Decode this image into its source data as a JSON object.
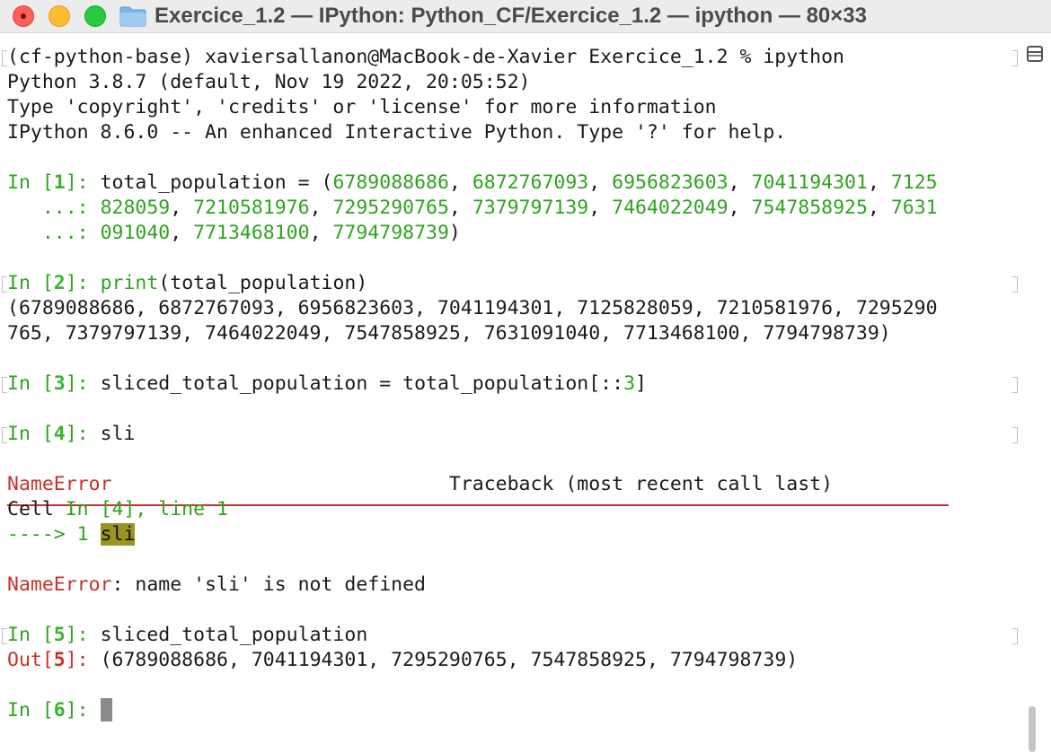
{
  "window": {
    "title": "Exercice_1.2 — IPython: Python_CF/Exercice_1.2 — ipython — 80×33",
    "icons": {
      "close": "close-icon",
      "minimize": "minimize-icon",
      "maximize": "maximize-icon",
      "folder": "folder-icon",
      "split": "split-view-icon"
    }
  },
  "colors": {
    "prompt_green": "#2fa31f",
    "error_red": "#c4332a",
    "highlight": "#9a9420"
  },
  "terminal": {
    "shell_prompt": "(cf-python-base) xaviersallanon@MacBook-de-Xavier Exercice_1.2 % ipython",
    "banner": [
      "Python 3.8.7 (default, Nov 19 2022, 20:05:52)",
      "Type 'copyright', 'credits' or 'license' for more information",
      "IPython 8.6.0 -- An enhanced Interactive Python. Type '?' for help."
    ],
    "cell1": {
      "prompt_in": "In [",
      "num": "1",
      "prompt_close": "]: ",
      "code_start": "total_population = (",
      "l1_values": [
        "6789088686",
        "6872767093",
        "6956823603",
        "7041194301",
        "7125"
      ],
      "cont": "   ...: ",
      "l2_values": [
        "828059",
        "7210581976",
        "7295290765",
        "7379797139",
        "7464022049",
        "7547858925",
        "7631"
      ],
      "l3_values": [
        "091040",
        "7713468100",
        "7794798739"
      ],
      "code_end": ")"
    },
    "cell2": {
      "num": "2",
      "func": "print",
      "args": "(total_population)",
      "output": [
        "(6789088686, 6872767093, 6956823603, 7041194301, 7125828059, 7210581976, 7295290",
        "765, 7379797139, 7464022049, 7547858925, 7631091040, 7713468100, 7794798739)"
      ]
    },
    "cell3": {
      "num": "3",
      "code_a": "sliced_total_population = total_population[::",
      "code_num": "3",
      "code_b": "]"
    },
    "cell4": {
      "num": "4",
      "code": "sli",
      "separator": "---------------------------------------------------------------------------",
      "error_name": "NameError",
      "traceback_label": "                             Traceback (most recent call last)",
      "cell_word": "Cell ",
      "cell_ref": "In [4], line 1",
      "arrow": "----> 1 ",
      "highlighted": "sli",
      "error_msg": ": name 'sli' is not defined"
    },
    "cell5": {
      "num": "5",
      "code": "sliced_total_population",
      "out_prompt": "Out[",
      "out_close": "]: ",
      "output": "(6789088686, 7041194301, 7295290765, 7547858925, 7794798739)"
    },
    "cell6": {
      "num": "6"
    }
  }
}
